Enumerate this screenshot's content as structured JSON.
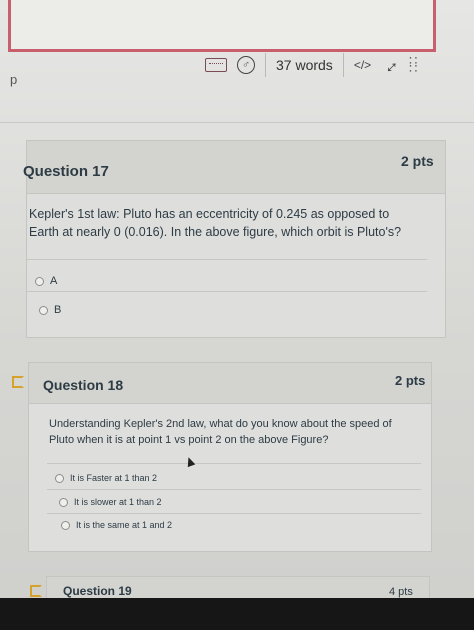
{
  "editor": {
    "word_count": "37 words",
    "code_label": "</>",
    "paragraph_indicator": "p"
  },
  "questions": [
    {
      "title": "Question 17",
      "points": "2 pts",
      "text": "Kepler's 1st law: Pluto has an eccentricity of 0.245 as opposed to Earth at nearly 0 (0.016). In the above figure, which orbit is Pluto's?",
      "options": [
        "A",
        "B"
      ]
    },
    {
      "title": "Question 18",
      "points": "2 pts",
      "text": "Understanding Kepler's 2nd law, what do you know about the speed of Pluto when it is at point 1 vs point 2 on the above Figure?",
      "options": [
        "It is Faster at 1 than 2",
        "It is slower at 1 than 2",
        "It is the same at 1 and 2"
      ]
    },
    {
      "title": "Question 19",
      "points": "4 pts"
    }
  ],
  "colors": {
    "editor_border": "#c7606c",
    "flag": "#d8a12c"
  }
}
